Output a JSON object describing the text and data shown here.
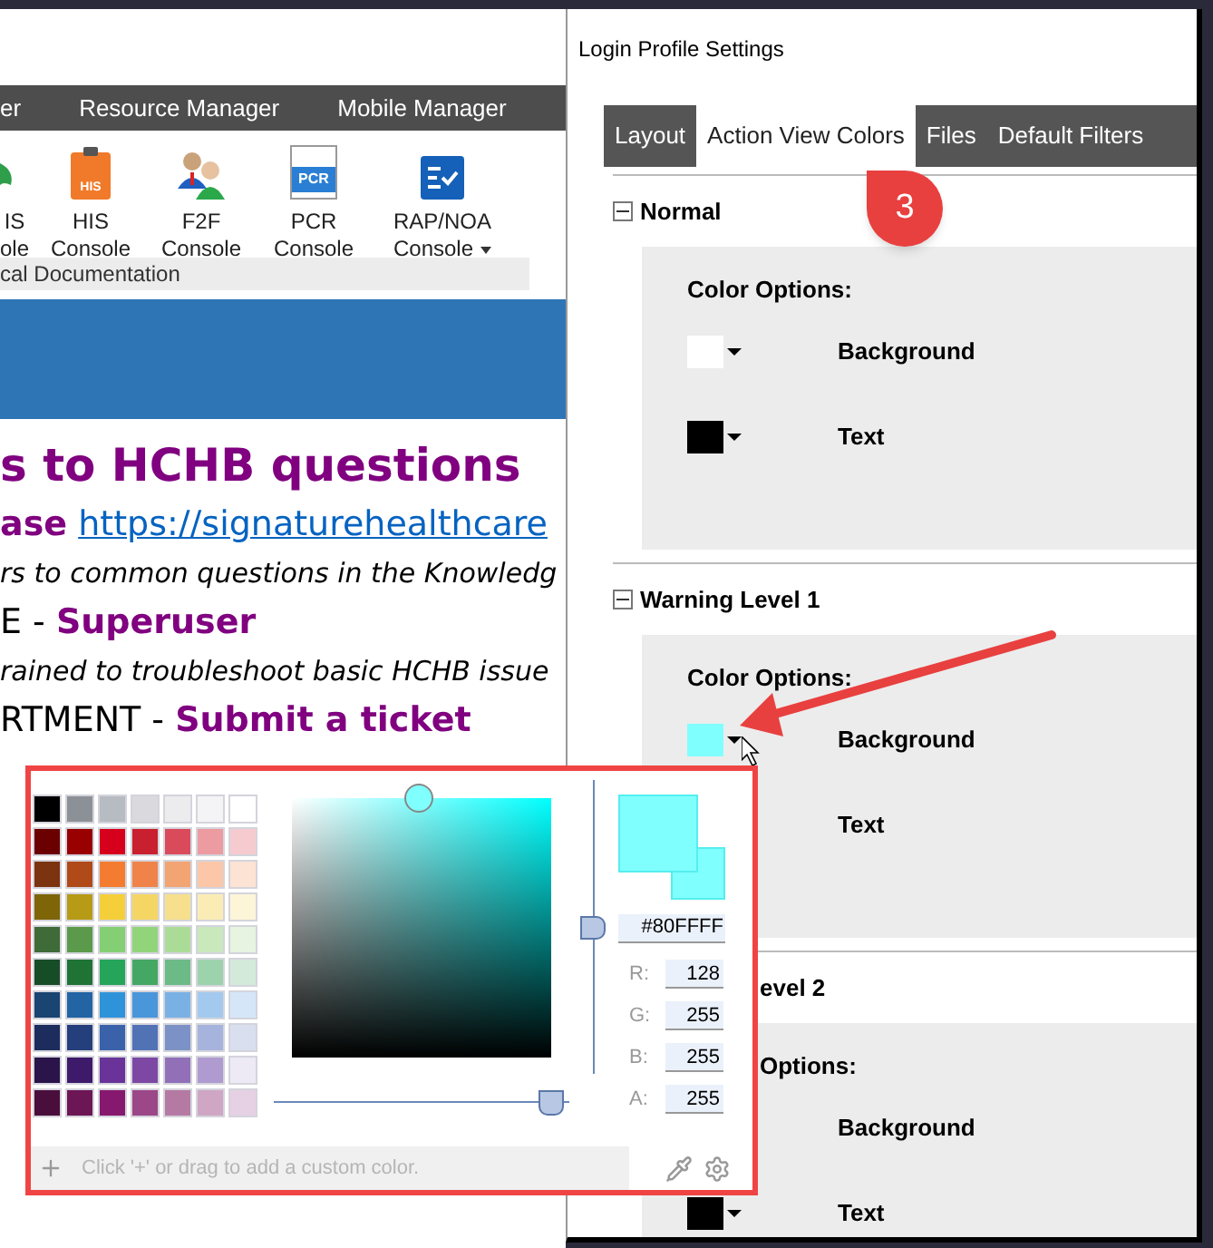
{
  "left_window": {
    "menu": [
      {
        "label": "er"
      },
      {
        "label": "Resource Manager"
      },
      {
        "label": "Mobile Manager"
      }
    ],
    "ribbon": {
      "items": [
        {
          "kind": "partial",
          "lines": [
            "IS",
            "ole"
          ]
        },
        {
          "kind": "clipboard",
          "icon_text": "HIS",
          "lines": [
            "HIS",
            "Console"
          ]
        },
        {
          "kind": "people",
          "lines": [
            "F2F",
            "Console"
          ]
        },
        {
          "kind": "document",
          "icon_text": "PCR",
          "lines": [
            "PCR",
            "Console"
          ]
        },
        {
          "kind": "checklist",
          "lines": [
            "RAP/NOA",
            "Console"
          ],
          "dropdown": true
        }
      ],
      "group_label": "cal Documentation"
    },
    "content": [
      {
        "kind": "heading",
        "text": "s to HCHB questions"
      },
      {
        "kind": "link_line",
        "lead": "ase",
        "link": "https://signaturehealthcare"
      },
      {
        "kind": "note",
        "text": "rs to common questions in the Knowledg"
      },
      {
        "kind": "contact",
        "lead": "E - ",
        "action": "Superuser"
      },
      {
        "kind": "note",
        "text": "rained to troubleshoot basic HCHB issue"
      },
      {
        "kind": "contact",
        "lead": "RTMENT - ",
        "action": "Submit a ticket"
      }
    ]
  },
  "dialog": {
    "title": "Login Profile Settings",
    "tabs": [
      {
        "label": "Layout",
        "selected": false
      },
      {
        "label": "Action View Colors",
        "selected": true
      },
      {
        "label": "Files",
        "selected": false
      },
      {
        "label": "Default Filters",
        "selected": false
      }
    ],
    "sections": [
      {
        "title": "Normal",
        "collapse_icon": true,
        "options_label": "Color Options:",
        "rows": [
          {
            "label": "Background",
            "color": "#ffffff"
          },
          {
            "label": "Text",
            "color": "#000000"
          }
        ]
      },
      {
        "title": "Warning Level 1",
        "collapse_icon": true,
        "options_label": "Color Options:",
        "rows": [
          {
            "label": "Background",
            "color": "#80ffff"
          },
          {
            "label": "Text"
          }
        ]
      },
      {
        "title": "evel 2",
        "collapse_icon": false,
        "options_label": "Options:",
        "rows": [
          {
            "label": "Background"
          },
          {
            "label": "Text",
            "color": "#000000"
          }
        ]
      }
    ]
  },
  "picker": {
    "palette": [
      {
        "color": "#000000"
      },
      {
        "color": "#8c9197"
      },
      {
        "color": "#b6bcc2"
      },
      {
        "color": "#d9d9de"
      },
      {
        "color": "#ececef"
      },
      {
        "color": "#f4f4f7"
      },
      {
        "color": "#ffffff"
      },
      {
        "color": "#6b0000"
      },
      {
        "color": "#990000"
      },
      {
        "color": "#d6001c"
      },
      {
        "color": "#c8202f"
      },
      {
        "color": "#d94b5a"
      },
      {
        "color": "#ec9ba1"
      },
      {
        "color": "#f5cbd0"
      },
      {
        "color": "#7b3310"
      },
      {
        "color": "#b04a18"
      },
      {
        "color": "#f47c30"
      },
      {
        "color": "#ef834a"
      },
      {
        "color": "#f2a472"
      },
      {
        "color": "#fbc7a8"
      },
      {
        "color": "#fde3d4"
      },
      {
        "color": "#7d6508"
      },
      {
        "color": "#b79a16"
      },
      {
        "color": "#f5cf3a"
      },
      {
        "color": "#f5d665"
      },
      {
        "color": "#f7e08d"
      },
      {
        "color": "#faecb4"
      },
      {
        "color": "#fdf5d8"
      },
      {
        "color": "#3e6b37"
      },
      {
        "color": "#5a9a4a"
      },
      {
        "color": "#84cf74"
      },
      {
        "color": "#92d47a"
      },
      {
        "color": "#abdc97"
      },
      {
        "color": "#c9e8bc"
      },
      {
        "color": "#e6f4e0"
      },
      {
        "color": "#174d26"
      },
      {
        "color": "#1f7335"
      },
      {
        "color": "#25a55a"
      },
      {
        "color": "#44a764"
      },
      {
        "color": "#6cbb86"
      },
      {
        "color": "#9dd3ac"
      },
      {
        "color": "#d3eadb"
      },
      {
        "color": "#1a4472"
      },
      {
        "color": "#2264a4"
      },
      {
        "color": "#2f93d9"
      },
      {
        "color": "#4a96da"
      },
      {
        "color": "#79b1e4"
      },
      {
        "color": "#a3caee"
      },
      {
        "color": "#d4e6f7"
      },
      {
        "color": "#1c2c5d"
      },
      {
        "color": "#243f7c"
      },
      {
        "color": "#3a62ab"
      },
      {
        "color": "#5272b6"
      },
      {
        "color": "#7c92c6"
      },
      {
        "color": "#a6b3dc"
      },
      {
        "color": "#d9dfee"
      },
      {
        "color": "#2a1449"
      },
      {
        "color": "#3e1a6b"
      },
      {
        "color": "#6a3399"
      },
      {
        "color": "#7c48a3"
      },
      {
        "color": "#9170b8"
      },
      {
        "color": "#b09bd0"
      },
      {
        "color": "#ede9f5"
      },
      {
        "color": "#4a0e3c"
      },
      {
        "color": "#6c1655"
      },
      {
        "color": "#86196f"
      },
      {
        "color": "#9c4787"
      },
      {
        "color": "#b57aa4"
      },
      {
        "color": "#cfa6c4"
      },
      {
        "color": "#e6d0e3"
      }
    ],
    "hue_slider": {
      "level": 0.5
    },
    "alpha_slider": {
      "level": 0.94
    },
    "preview": {
      "current": {
        "color": "#80ffff"
      },
      "previous": {
        "color": "#80ffff"
      }
    },
    "hex": "#80FFFF",
    "channels": [
      {
        "label": "R:",
        "value": "128"
      },
      {
        "label": "G:",
        "value": "255"
      },
      {
        "label": "B:",
        "value": "255"
      },
      {
        "label": "A:",
        "value": "255"
      }
    ],
    "custom_placeholder": "Click '+' or drag to add a custom color."
  },
  "callout": {
    "text": "3"
  }
}
